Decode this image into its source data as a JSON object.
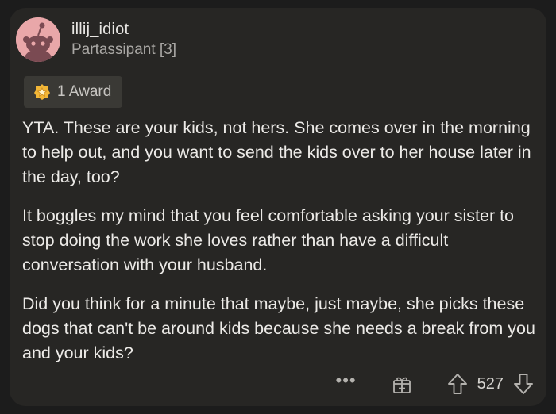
{
  "comment": {
    "username": "illij_idiot",
    "flair": "Partassipant [3]",
    "award_label": "1 Award",
    "paragraphs": [
      "YTA. These are your kids, not hers. She comes over in the morning to help out, and you want to send the kids over to her house later in the day, too?",
      "It boggles my mind that you feel comfortable asking your sister to stop doing the work she loves rather than have a difficult conversation with your husband.",
      "Did you think for a minute that maybe, just maybe, she picks these dogs that can't be around kids because she needs a break from you and your kids?"
    ],
    "vote_count": "527"
  },
  "actions": {
    "more_label": "•••"
  },
  "icons": {
    "avatar": "snoo-avatar",
    "award": "award-medal-icon",
    "give_award": "gift-award-icon",
    "upvote": "upvote-arrow-icon",
    "downvote": "downvote-arrow-icon"
  },
  "colors": {
    "background": "#1c1c1c",
    "card": "#272624",
    "avatar": "#e9a7a9",
    "award_gold": "#f2b637"
  }
}
